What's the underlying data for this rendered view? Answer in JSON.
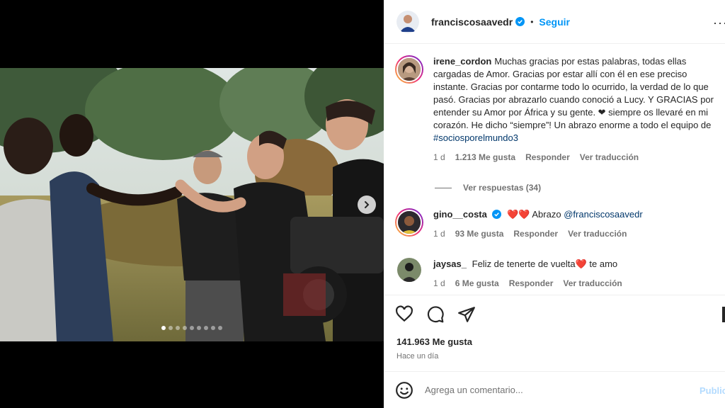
{
  "post": {
    "author": "franciscosaavedr",
    "separator": "•",
    "follow_label": "Seguir",
    "more_icon": "more-horizontal-icon",
    "carousel": {
      "slide_count": 9,
      "active_slide": 1
    }
  },
  "comments": [
    {
      "user": "irene_cordon",
      "text": "Muchas gracias por estas palabras, todas ellas cargadas de Amor. Gracias por estar allí con él en ese preciso instante. Gracias por contarme todo lo ocurrido, la verdad de lo que pasó. Gracias por abrazarlo cuando conoció a Lucy. Y GRACIAS por entender su Amor por África y su gente. ❤ siempre os llevaré en mi corazón. He dicho “siempre”! Un abrazo enorme a todo el equipo de",
      "hashtag": "#sociosporelmundo3",
      "time": "1 d",
      "likes": "1.213 Me gusta",
      "reply": "Responder",
      "translate": "Ver traducción",
      "view_replies": "Ver respuestas (34)"
    },
    {
      "user": "gino__costa",
      "hearts": "❤️❤️",
      "text": "Abrazo",
      "mention": "@franciscosaavedr",
      "time": "1 d",
      "likes": "93 Me gusta",
      "reply": "Responder",
      "translate": "Ver traducción"
    },
    {
      "user": "jaysas_",
      "text_before": "Feliz de tenerte de vuelta",
      "heart": "❤️",
      "text_after": "te amo",
      "time": "1 d",
      "likes": "6 Me gusta",
      "reply": "Responder",
      "translate": "Ver traducción"
    }
  ],
  "stats": {
    "likes": "141.963 Me gusta",
    "time_ago": "Hace un día"
  },
  "comment_box": {
    "placeholder": "Agrega un comentario...",
    "publish": "Publicar"
  },
  "colors": {
    "accent": "#0095f6",
    "link": "#00376b",
    "muted": "#737373",
    "heart": "#ed4956"
  }
}
